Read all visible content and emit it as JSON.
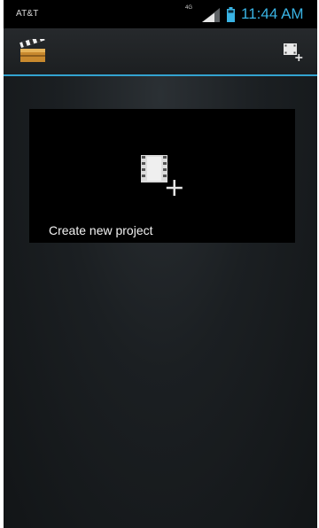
{
  "status_bar": {
    "carrier": "AT&T",
    "network_type": "4G",
    "time": "11:44 AM",
    "signal_icon": "signal-bars-icon",
    "battery_icon": "battery-icon"
  },
  "action_bar": {
    "app_icon": "clapperboard-icon",
    "new_project_icon": "add-video-icon"
  },
  "main": {
    "create_tile": {
      "label": "Create new project",
      "icon": "film-plus-icon"
    }
  },
  "colors": {
    "accent_blue": "#33a3d0",
    "clock_blue": "#39b3e4",
    "tile_background": "#000000"
  }
}
